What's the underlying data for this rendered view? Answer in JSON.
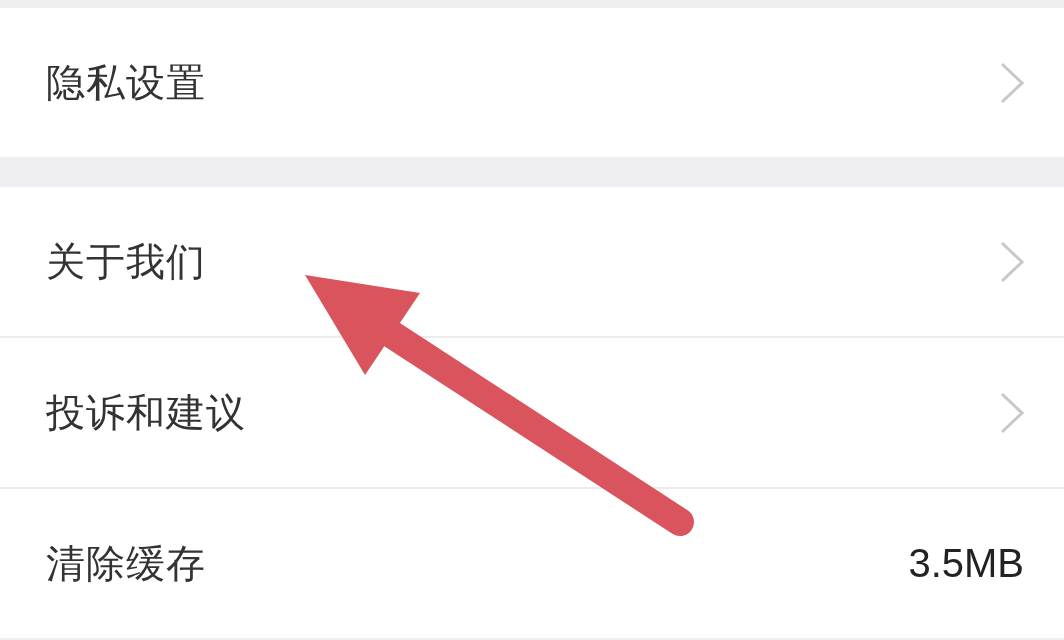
{
  "groups": [
    {
      "rows": [
        {
          "kind": "link",
          "label": "隐私设置"
        }
      ]
    },
    {
      "rows": [
        {
          "kind": "link",
          "label": "关于我们"
        },
        {
          "kind": "link",
          "label": "投诉和建议"
        },
        {
          "kind": "value",
          "label": "清除缓存",
          "value": "3.5MB"
        }
      ]
    }
  ],
  "annotations": [
    {
      "kind": "arrow"
    }
  ]
}
